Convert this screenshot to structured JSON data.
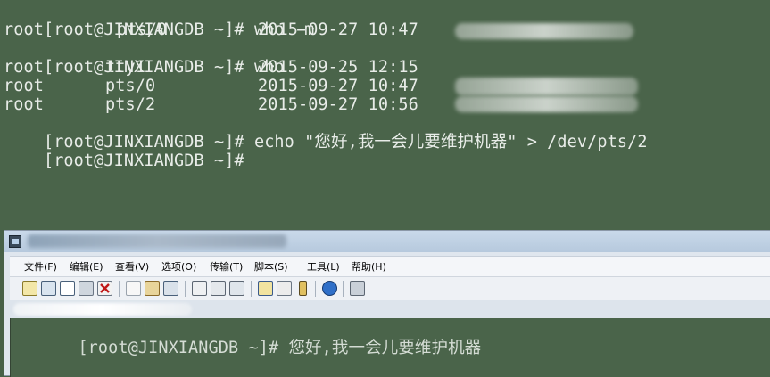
{
  "terminal_top": {
    "line1": {
      "prompt": "[root@JINXIANGDB ~]# ",
      "command": "who -m"
    },
    "line2": {
      "user": "root",
      "tty": "pts/0",
      "time": "2015-09-27 10:47"
    },
    "line3": {
      "prompt": "[root@JINXIANGDB ~]# ",
      "command": "who"
    },
    "line4": {
      "user": "root",
      "tty": "tty1",
      "time": "2015-09-25 12:15"
    },
    "line5": {
      "user": "root",
      "tty": "pts/0",
      "time": "2015-09-27 10:47"
    },
    "line6": {
      "user": "root",
      "tty": "pts/2",
      "time": "2015-09-27 10:56"
    },
    "line7": {
      "prompt": "[root@JINXIANGDB ~]# ",
      "command": "echo \"您好,我一会儿要维护机器\" > /dev/pts/2"
    },
    "line8": {
      "prompt": "[root@JINXIANGDB ~]#"
    }
  },
  "window": {
    "menu": [
      "文件(F)",
      "编辑(E)",
      "查看(V)",
      "选项(O)",
      "传输(T)",
      "脚本(S)",
      "工具(L)",
      "帮助(H)"
    ],
    "toolbar_icons": [
      "connect-icon",
      "quick-connect-icon",
      "connect-tab-icon",
      "reconnect-icon",
      "disconnect-icon",
      "copy-icon",
      "paste-icon",
      "find-icon",
      "print-setup-icon",
      "print-icon",
      "print-screen-icon",
      "session-options-icon",
      "global-options-icon",
      "keymap-icon",
      "help-icon",
      "sftp-icon"
    ]
  },
  "terminal_bottom": {
    "prompt": "[root@JINXIANGDB ~]# ",
    "message": "您好,我一会儿要维护机器"
  },
  "colors": {
    "terminal_bg": "#4a644a",
    "terminal_fg": "#e8ece8",
    "window_chrome": "#dfe6ee"
  }
}
